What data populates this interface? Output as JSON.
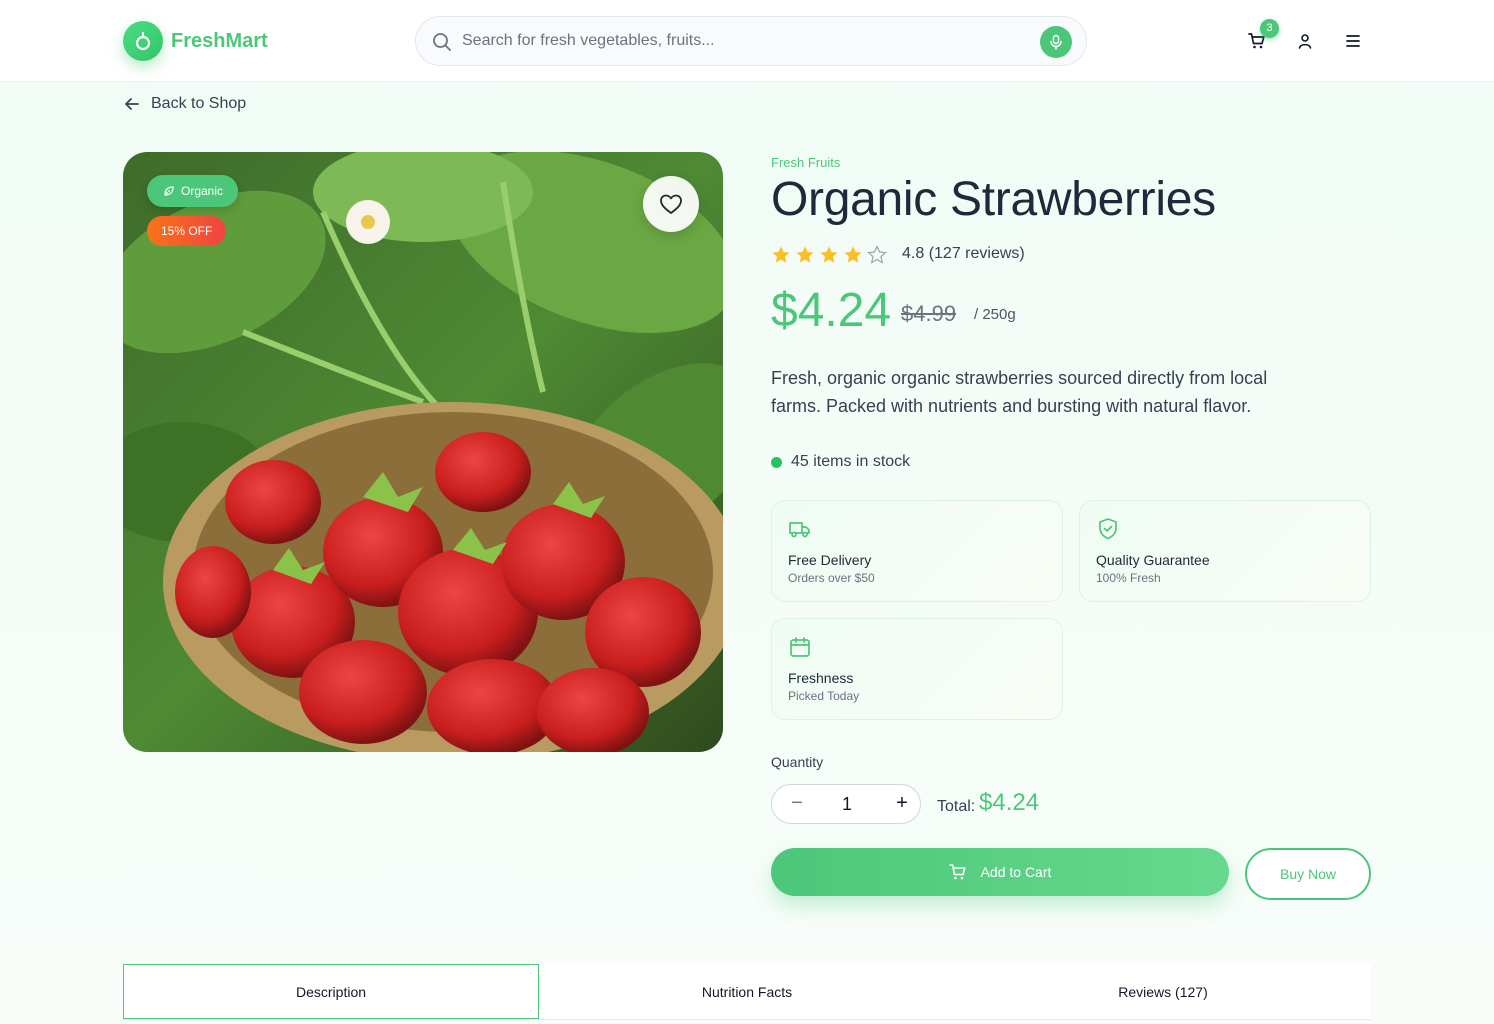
{
  "header": {
    "brand": "FreshMart",
    "search_placeholder": "Search for fresh vegetables, fruits...",
    "cart_count": "3"
  },
  "nav": {
    "back_label": "Back to Shop"
  },
  "image": {
    "badge_organic": "Organic",
    "badge_discount": "15% OFF"
  },
  "product": {
    "category": "Fresh Fruits",
    "name": "Organic Strawberries",
    "rating": 4.8,
    "rating_text": "4.8 (127 reviews)",
    "price": "$4.24",
    "old_price": "$4.99",
    "unit": "/ 250g",
    "description": "Fresh, organic organic strawberries sourced directly from local farms. Packed with nutrients and bursting with natural flavor.",
    "stock": "45 items in stock"
  },
  "features": [
    {
      "icon": "truck-icon",
      "title": "Free Delivery",
      "subtitle": "Orders over $50"
    },
    {
      "icon": "shield-check-icon",
      "title": "Quality Guarantee",
      "subtitle": "100% Fresh"
    },
    {
      "icon": "calendar-icon",
      "title": "Freshness",
      "subtitle": "Picked Today"
    }
  ],
  "purchase": {
    "quantity_label": "Quantity",
    "quantity": "1",
    "minus": "−",
    "plus": "+",
    "total_label": "Total:",
    "total_value": "$4.24",
    "add_to_cart": "Add to Cart",
    "buy_now": "Buy Now"
  },
  "tabs": [
    {
      "label": "Description",
      "active": true
    },
    {
      "label": "Nutrition Facts",
      "active": false
    },
    {
      "label": "Reviews (127)",
      "active": false
    }
  ],
  "colors": {
    "accent": "#4cc77a",
    "title": "#1e293b",
    "star": "#fbbf24",
    "discount_from": "#f97316",
    "discount_to": "#ef4444"
  }
}
